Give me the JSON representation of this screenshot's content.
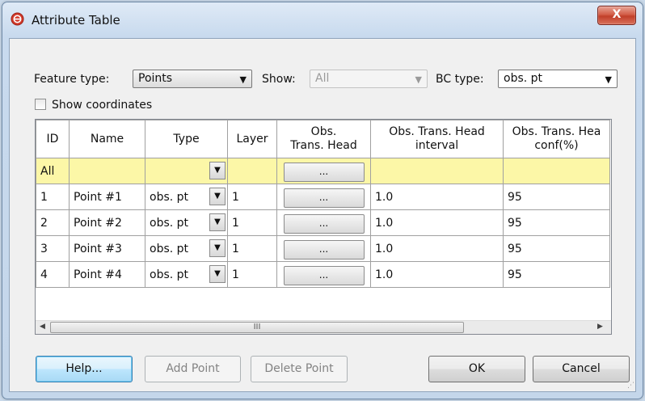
{
  "window": {
    "title": "Attribute Table",
    "close_label": "X",
    "icon": "app-logo-icon"
  },
  "filters": {
    "feature_type_label": "Feature type:",
    "feature_type_value": "Points",
    "show_label": "Show:",
    "show_value": "All",
    "bc_type_label": "BC type:",
    "bc_type_value": "obs. pt",
    "show_coordinates_label": "Show coordinates",
    "show_coordinates_checked": false
  },
  "table": {
    "columns": [
      "ID",
      "Name",
      "Type",
      "Layer",
      "Obs.\nTrans. Head",
      "Obs. Trans. Head\ninterval",
      "Obs. Trans. Hea\nconf(%)"
    ],
    "all_row": {
      "id": "All",
      "ellipsis": "..."
    },
    "rows": [
      {
        "id": "1",
        "name": "Point #1",
        "type": "obs. pt",
        "layer": "1",
        "head": "...",
        "interval": "1.0",
        "conf": "95"
      },
      {
        "id": "2",
        "name": "Point #2",
        "type": "obs. pt",
        "layer": "1",
        "head": "...",
        "interval": "1.0",
        "conf": "95"
      },
      {
        "id": "3",
        "name": "Point #3",
        "type": "obs. pt",
        "layer": "1",
        "head": "...",
        "interval": "1.0",
        "conf": "95"
      },
      {
        "id": "4",
        "name": "Point #4",
        "type": "obs. pt",
        "layer": "1",
        "head": "...",
        "interval": "1.0",
        "conf": "95"
      }
    ]
  },
  "buttons": {
    "help": "Help...",
    "add_point": "Add Point",
    "delete_point": "Delete Point",
    "ok": "OK",
    "cancel": "Cancel"
  }
}
